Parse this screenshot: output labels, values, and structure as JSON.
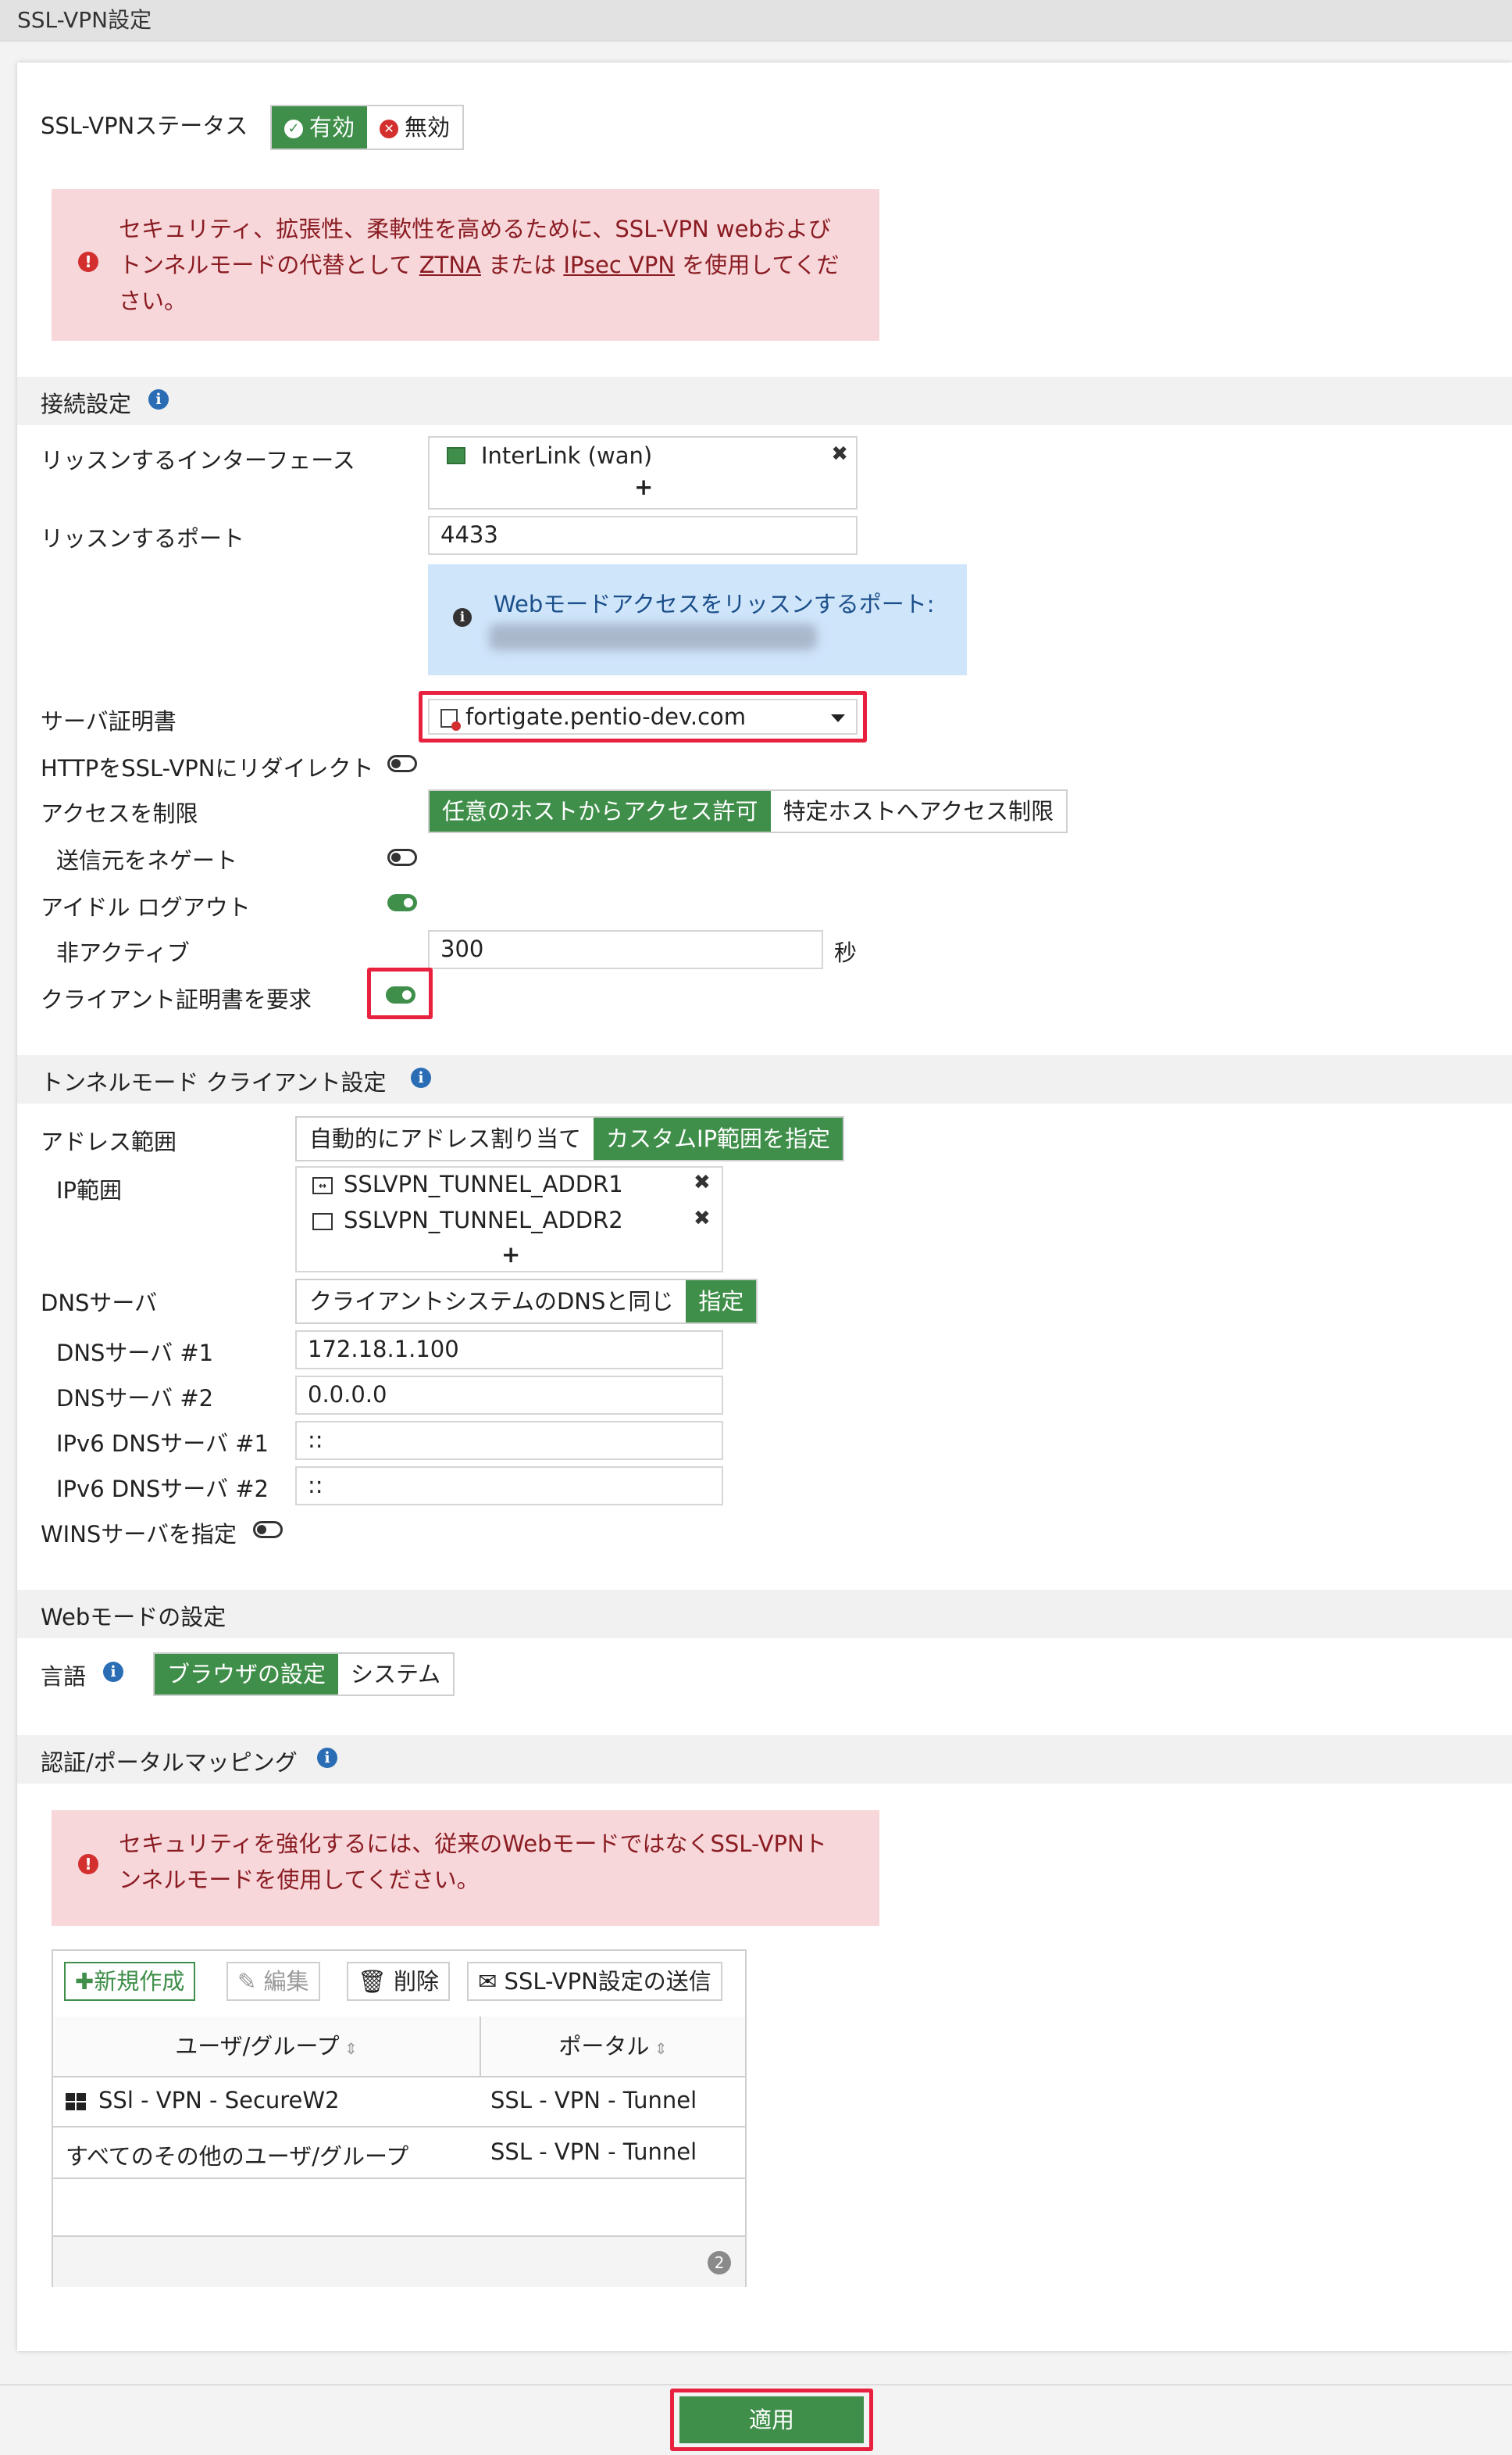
{
  "page_title": "SSL-VPN設定",
  "status": {
    "label": "SSL-VPNステータス",
    "enabled_label": "有効",
    "disabled_label": "無効"
  },
  "alert_top": {
    "line1": "セキュリティ、拡張性、柔軟性を高めるために、SSL-VPN webおよび",
    "line2_a": "トンネルモードの代替として ",
    "link_ztna": "ZTNA",
    "line2_b": " または ",
    "link_ipsec": "IPsec VPN",
    "line2_c": " を使用してくだ",
    "line3": "さい。"
  },
  "connection": {
    "section_title": "接続設定",
    "listen_interface_label": "リッスンするインターフェース",
    "interface_value": "InterLink (wan)",
    "add_symbol": "+",
    "remove_symbol": "✖",
    "listen_port_label": "リッスンするポート",
    "listen_port_value": "4433",
    "web_port_info": "Webモードアクセスをリッスンするポート:",
    "server_cert_label": "サーバ証明書",
    "server_cert_value": "fortigate.pentio-dev.com",
    "http_redirect_label": "HTTPをSSL-VPNにリダイレクト",
    "http_redirect_on": false,
    "access_restrict_label": "アクセスを制限",
    "access_allow_any": "任意のホストからアクセス許可",
    "access_limit_specific": "特定ホストへアクセス制限",
    "negate_source_label": "送信元をネゲート",
    "negate_source_on": false,
    "idle_logout_label": "アイドル ログアウト",
    "idle_logout_on": true,
    "inactive_label": "非アクティブ",
    "inactive_value": "300",
    "inactive_unit": "秒",
    "require_client_cert_label": "クライアント証明書を要求",
    "require_client_cert_on": true
  },
  "tunnel": {
    "section_title": "トンネルモード クライアント設定",
    "address_range_label": "アドレス範囲",
    "address_auto": "自動的にアドレス割り当て",
    "address_custom": "カスタムIP範囲を指定",
    "ip_range_label": "IP範囲",
    "ip_ranges": [
      "SSLVPN_TUNNEL_ADDR1",
      "SSLVPN_TUNNEL_ADDR2"
    ],
    "dns_server_label": "DNSサーバ",
    "dns_same_as_client": "クライアントシステムのDNSと同じ",
    "dns_specify": "指定",
    "dns1_label": "DNSサーバ #1",
    "dns1_value": "172.18.1.100",
    "dns2_label": "DNSサーバ #2",
    "dns2_value": "0.0.0.0",
    "ipv6_dns1_label": "IPv6 DNSサーバ #1",
    "ipv6_dns1_value": "::",
    "ipv6_dns2_label": "IPv6 DNSサーバ #2",
    "ipv6_dns2_value": "::",
    "wins_label": "WINSサーバを指定",
    "wins_on": false
  },
  "web_mode": {
    "section_title": "Webモードの設定",
    "language_label": "言語",
    "lang_browser": "ブラウザの設定",
    "lang_system": "システム"
  },
  "auth_portal": {
    "section_title": "認証/ポータルマッピング",
    "alert_line1": "セキュリティを強化するには、従来のWebモードではなくSSL-VPNト",
    "alert_line2": "ンネルモードを使用してください。",
    "toolbar": {
      "new_label": "新規作成",
      "edit_label": "編集",
      "delete_label": "削除",
      "send_label": "SSL-VPN設定の送信"
    },
    "columns": [
      "ユーザ/グループ",
      "ポータル"
    ],
    "rows": [
      {
        "user": "SSl - VPN - SecureW2",
        "portal": "SSL - VPN - Tunnel"
      },
      {
        "user": "すべてのその他のユーザ/グループ",
        "portal": "SSL - VPN - Tunnel"
      }
    ],
    "count": "2"
  },
  "apply_label": "適用",
  "colors": {
    "accent_green": "#3f8f4a",
    "alert_bg": "#f7d7da",
    "alert_text": "#8a1c22",
    "highlight_red": "#e8213f",
    "info_bg": "#cfe5fa"
  }
}
